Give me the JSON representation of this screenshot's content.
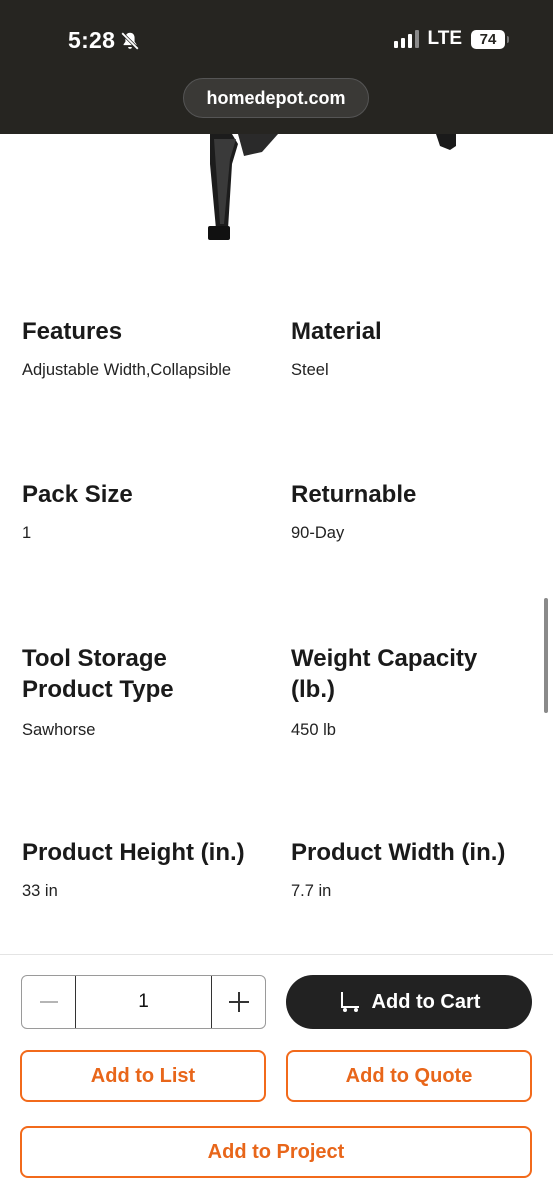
{
  "status_bar": {
    "time": "5:28",
    "network": "LTE",
    "battery": "74"
  },
  "browser": {
    "url": "homedepot.com"
  },
  "specs": [
    {
      "label": "Features",
      "value": "Adjustable Width,Collapsible"
    },
    {
      "label": "Material",
      "value": "Steel"
    },
    {
      "label": "Pack Size",
      "value": "1"
    },
    {
      "label": "Returnable",
      "value": "90-Day"
    },
    {
      "label": "Tool Storage Product Type",
      "value": "Sawhorse"
    },
    {
      "label": "Weight Capacity (lb.)",
      "value": "450 lb"
    },
    {
      "label": "Product Height (in.)",
      "value": "33 in"
    },
    {
      "label": "Product Width (in.)",
      "value": "7.7 in"
    }
  ],
  "cart": {
    "quantity": "1",
    "add_to_cart": "Add to Cart",
    "add_to_list": "Add to List",
    "add_to_quote": "Add to Quote",
    "add_to_project": "Add to Project"
  },
  "colors": {
    "topbar": "#262521",
    "accent_orange": "#f26a1b",
    "cart_button": "#222222"
  },
  "icons": {
    "silent_mode": "bell-slash-icon",
    "signal": "signal-bars-icon",
    "minus": "minus-icon",
    "plus": "plus-icon",
    "cart": "cart-icon"
  }
}
